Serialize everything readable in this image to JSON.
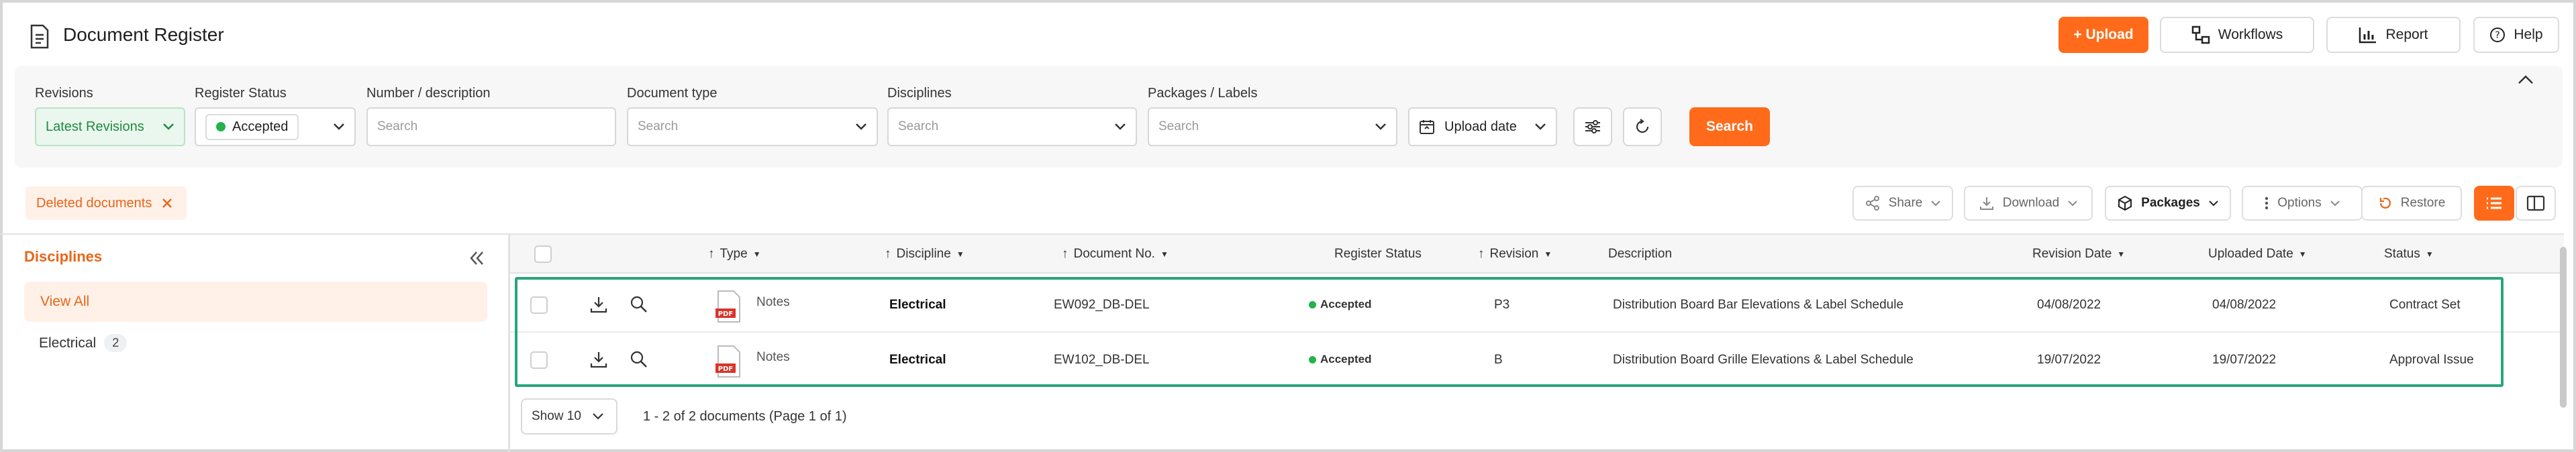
{
  "header": {
    "title": "Document Register",
    "buttons": {
      "upload": "+ Upload",
      "workflows": "Workflows",
      "report": "Report",
      "help": "Help"
    }
  },
  "filters": {
    "revisions": {
      "label": "Revisions",
      "value": "Latest Revisions"
    },
    "register_status": {
      "label": "Register Status",
      "value": "Accepted"
    },
    "number_description": {
      "label": "Number / description",
      "placeholder": "Search"
    },
    "document_type": {
      "label": "Document type",
      "placeholder": "Search"
    },
    "disciplines": {
      "label": "Disciplines",
      "placeholder": "Search"
    },
    "packages_labels": {
      "label": "Packages / Labels",
      "placeholder": "Search"
    },
    "upload_date": "Upload date",
    "search_button": "Search"
  },
  "chips": {
    "deleted_documents": "Deleted documents"
  },
  "toolbar": {
    "share": "Share",
    "download": "Download",
    "packages": "Packages",
    "options": "Options",
    "restore": "Restore"
  },
  "sidebar": {
    "title": "Disciplines",
    "view_all": "View All",
    "items": [
      {
        "label": "Electrical",
        "count": "2"
      }
    ]
  },
  "table": {
    "columns": {
      "type": "Type",
      "discipline": "Discipline",
      "document_no": "Document No.",
      "register_status": "Register Status",
      "revision": "Revision",
      "description": "Description",
      "revision_date": "Revision Date",
      "uploaded_date": "Uploaded Date",
      "status": "Status"
    },
    "rows": [
      {
        "type": "Notes",
        "discipline": "Electrical",
        "document_no": "EW092_DB-DEL",
        "register_status": "Accepted",
        "revision": "P3",
        "description": "Distribution Board Bar Elevations & Label Schedule",
        "revision_date": "04/08/2022",
        "uploaded_date": "04/08/2022",
        "status": "Contract Set"
      },
      {
        "type": "Notes",
        "discipline": "Electrical",
        "document_no": "EW102_DB-DEL",
        "register_status": "Accepted",
        "revision": "B",
        "description": "Distribution Board Grille Elevations & Label Schedule",
        "revision_date": "19/07/2022",
        "uploaded_date": "19/07/2022",
        "status": "Approval Issue"
      }
    ]
  },
  "footer": {
    "page_size": "Show 10",
    "summary": "1 - 2 of 2 documents (Page 1 of 1)"
  },
  "colors": {
    "accent": "#ff6b1a",
    "success": "#22b34a",
    "highlight": "#2aa57a"
  }
}
